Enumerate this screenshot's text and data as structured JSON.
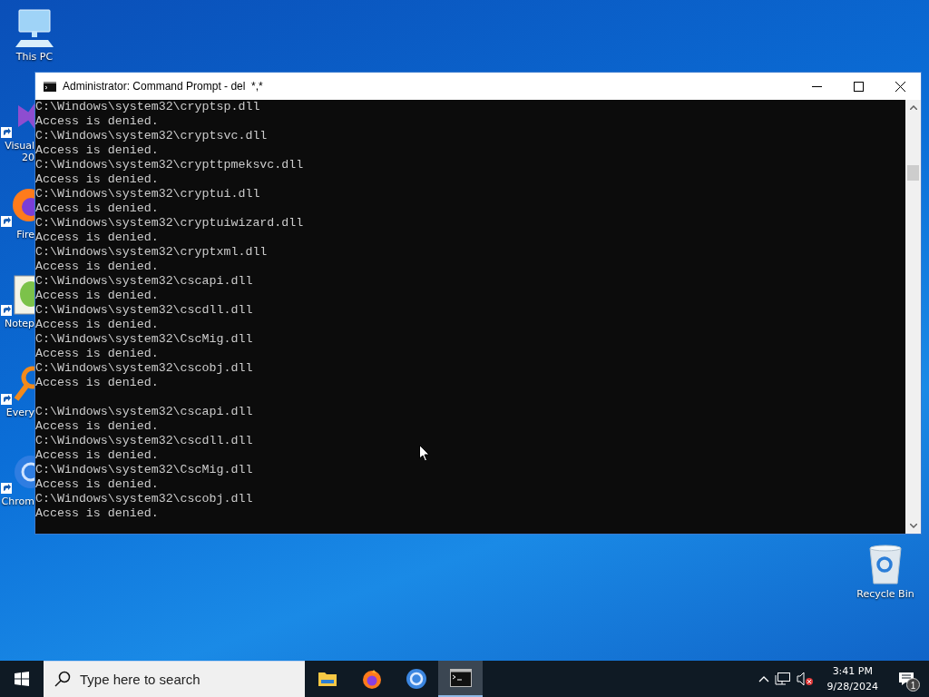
{
  "desktop_icons": [
    {
      "kind": "computer",
      "lines": [
        "This PC"
      ]
    },
    {
      "kind": "visual",
      "lines": [
        "Visual",
        "20"
      ]
    },
    {
      "kind": "firefox",
      "lines": [
        "Fire"
      ]
    },
    {
      "kind": "notepad",
      "lines": [
        "Notep"
      ]
    },
    {
      "kind": "everything",
      "lines": [
        "Every"
      ]
    },
    {
      "kind": "chrome",
      "lines": [
        "Chrom"
      ]
    }
  ],
  "recycle_bin": {
    "label": "Recycle Bin"
  },
  "window": {
    "title": "Administrator: Command Prompt - del  *,*",
    "console": {
      "blocks": [
        {
          "lines": [
            "C:\\Windows\\system32\\cryptsp.dll",
            "Access is denied.",
            "C:\\Windows\\system32\\cryptsvc.dll",
            "Access is denied.",
            "C:\\Windows\\system32\\crypttpmeksvc.dll",
            "Access is denied.",
            "C:\\Windows\\system32\\cryptui.dll",
            "Access is denied.",
            "C:\\Windows\\system32\\cryptuiwizard.dll",
            "Access is denied.",
            "C:\\Windows\\system32\\cryptxml.dll",
            "Access is denied.",
            "C:\\Windows\\system32\\cscapi.dll",
            "Access is denied.",
            "C:\\Windows\\system32\\cscdll.dll",
            "Access is denied.",
            "C:\\Windows\\system32\\CscMig.dll",
            "Access is denied.",
            "C:\\Windows\\system32\\cscobj.dll",
            "Access is denied."
          ]
        },
        {
          "lines": [
            "C:\\Windows\\system32\\cscapi.dll",
            "Access is denied.",
            "C:\\Windows\\system32\\cscdll.dll",
            "Access is denied.",
            "C:\\Windows\\system32\\CscMig.dll",
            "Access is denied.",
            "C:\\Windows\\system32\\cscobj.dll",
            "Access is denied."
          ]
        }
      ]
    }
  },
  "taskbar": {
    "search": {
      "placeholder": "Type here to search"
    },
    "apps": [
      {
        "kind": "explorer",
        "selected": false
      },
      {
        "kind": "firefox",
        "selected": false
      },
      {
        "kind": "chrome",
        "selected": false
      },
      {
        "kind": "terminal",
        "selected": true
      }
    ],
    "tray": {
      "volume_muted": true,
      "time": "3:41 PM",
      "date": "9/28/2024",
      "notification_count": "1"
    }
  }
}
